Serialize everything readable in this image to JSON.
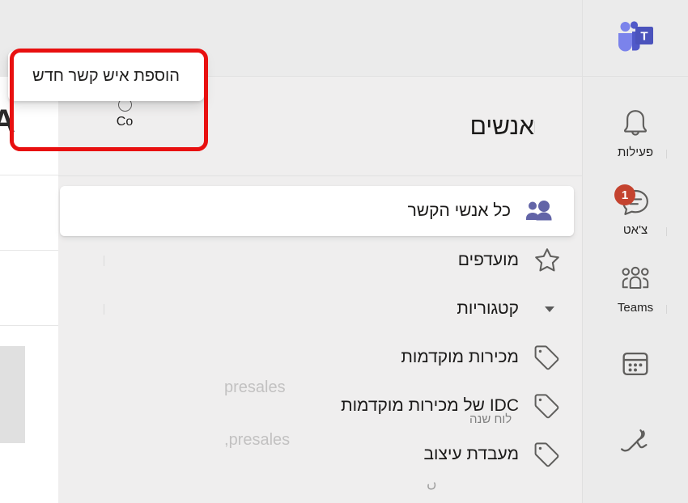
{
  "app": {
    "name": "Microsoft Teams",
    "logo_icon": "teams-logo-icon"
  },
  "tooltip": {
    "text": "הוספת איש קשר חדש",
    "annotation_color": "#e81010"
  },
  "left_panel": {
    "partial_glyph": "A"
  },
  "top_tab": {
    "label": "Co",
    "icon": "circle-outline-icon"
  },
  "header": {
    "title": "אנשים"
  },
  "list": {
    "items": [
      {
        "label": "כל אנשי הקשר",
        "icon": "people-group-icon",
        "selected": true
      },
      {
        "label": "מועדפים",
        "icon": "star-outline-icon",
        "selected": false
      },
      {
        "label": "קטגוריות",
        "icon": "chevron-down-icon",
        "selected": false,
        "is_section": true
      },
      {
        "label": "מכירות מוקדמות",
        "icon": "tag-icon",
        "selected": false
      },
      {
        "label": "IDC של מכירות מוקדמות",
        "icon": "tag-icon",
        "selected": false
      },
      {
        "label": "מעבדת עיצוב",
        "icon": "tag-icon",
        "selected": false
      }
    ]
  },
  "artifacts": {
    "ghost_a": "presales",
    "ghost_b": "presales,",
    "ghost_c": "לוח שנה",
    "ghost_d": "ں"
  },
  "rail": {
    "items": [
      {
        "label": "פעילות",
        "icon": "bell-icon",
        "badge": "",
        "ltr": false
      },
      {
        "label": "צ'אט",
        "icon": "chat-bubble-icon",
        "badge": "1",
        "ltr": false
      },
      {
        "label": "Teams",
        "icon": "teams-people-icon",
        "badge": "",
        "ltr": true
      },
      {
        "label": "",
        "icon": "calendar-icon",
        "badge": "",
        "ltr": false
      },
      {
        "label": "",
        "icon": "phone-icon",
        "badge": "",
        "ltr": false
      }
    ]
  },
  "colors": {
    "accent_purple": "#6264a7",
    "badge_red": "#c4432f",
    "annotation_red": "#e81010",
    "background_gray": "#ebebeb",
    "content_gray": "#efeeee"
  }
}
